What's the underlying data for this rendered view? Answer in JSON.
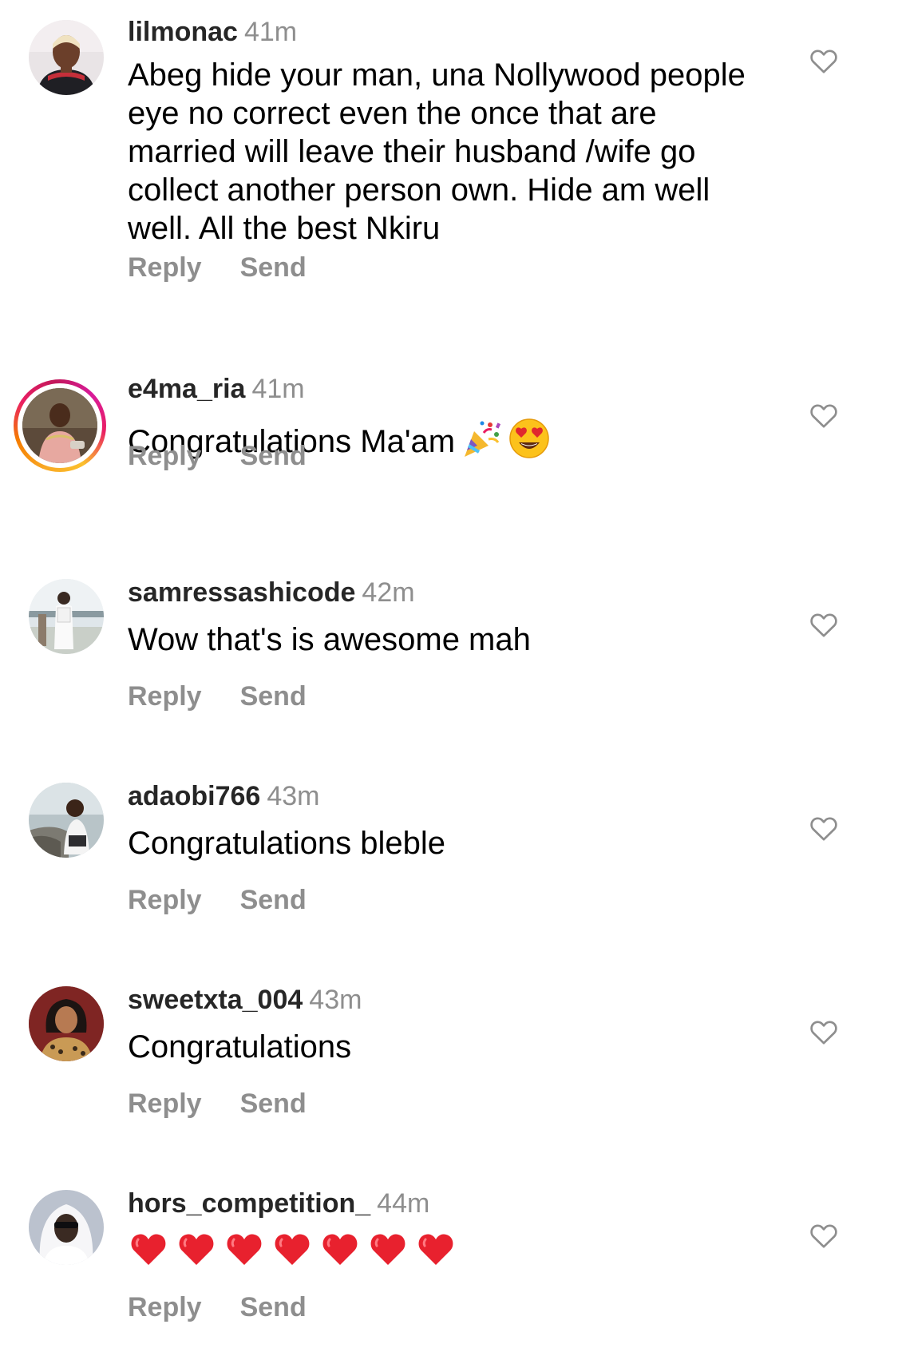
{
  "comments": [
    {
      "username": "lilmonac",
      "time": "41m",
      "text": "Abeg hide your man, una Nollywood people eye no correct even the once that are married will leave their husband /wife go collect another person own. Hide am well well. All the best Nkiru",
      "reply_label": "Reply",
      "send_label": "Send",
      "like_icon": "heart-outline-icon",
      "story_ring": false
    },
    {
      "username": "e4ma_ria",
      "time": "41m",
      "text": "Congratulations Ma'am",
      "emojis": [
        "party-popper-emoji",
        "heart-eyes-emoji"
      ],
      "reply_label": "Reply",
      "send_label": "Send",
      "like_icon": "heart-outline-icon",
      "story_ring": true
    },
    {
      "username": "samressashicode",
      "time": "42m",
      "text": "Wow that's is awesome mah",
      "reply_label": "Reply",
      "send_label": "Send",
      "like_icon": "heart-outline-icon",
      "story_ring": false
    },
    {
      "username": "adaobi766",
      "time": "43m",
      "text": "Congratulations bleble",
      "reply_label": "Reply",
      "send_label": "Send",
      "like_icon": "heart-outline-icon",
      "story_ring": false
    },
    {
      "username": "sweetxta_004",
      "time": "43m",
      "text": "Congratulations",
      "reply_label": "Reply",
      "send_label": "Send",
      "like_icon": "heart-outline-icon",
      "story_ring": false
    },
    {
      "username": "hors_competition_",
      "time": "44m",
      "text": "",
      "emojis": [
        "red-heart-emoji",
        "red-heart-emoji",
        "red-heart-emoji",
        "red-heart-emoji",
        "red-heart-emoji",
        "red-heart-emoji",
        "red-heart-emoji"
      ],
      "reply_label": "Reply",
      "send_label": "Send",
      "like_icon": "heart-outline-icon",
      "story_ring": false
    }
  ],
  "colors": {
    "username": "#262626",
    "meta_gray": "#8e8e8e",
    "body_text": "#000000",
    "story_ring": "#e91e63"
  }
}
